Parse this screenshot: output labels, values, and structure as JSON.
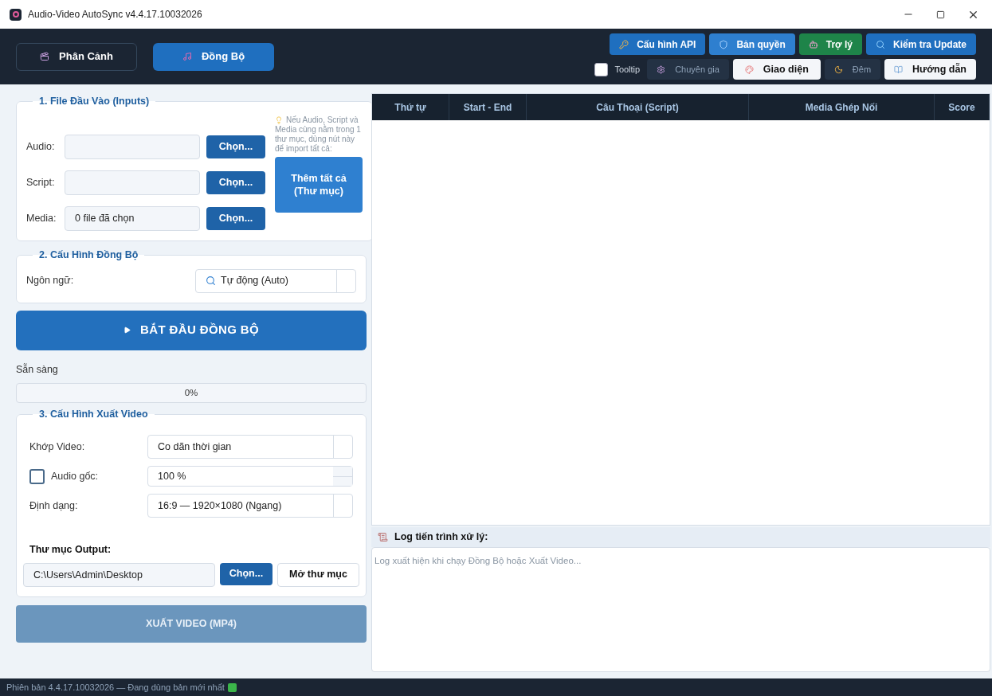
{
  "window": {
    "title": "Audio-Video AutoSync  v4.4.17.10032026"
  },
  "mode_tabs": [
    {
      "label": "Phân Cảnh",
      "selected": false
    },
    {
      "label": "Đồng Bộ",
      "selected": true
    }
  ],
  "top_buttons": [
    {
      "label": "Cấu hình API",
      "color": "#1f6fbf"
    },
    {
      "label": "Bản quyền",
      "color": "#2e7fcf"
    },
    {
      "label": "Trợ lý",
      "color": "#1e8449"
    },
    {
      "label": "Kiểm tra Update",
      "color": "#1f6fbf"
    }
  ],
  "tooltip_toggle": {
    "label": "Tooltip",
    "checked": false
  },
  "view_buttons": [
    {
      "label": "Chuyên gia",
      "selected": false
    },
    {
      "label": "Giao diện",
      "selected": true
    },
    {
      "label": "Đêm",
      "selected": false
    },
    {
      "label": "Hướng dẫn",
      "selected": true
    }
  ],
  "inputs": {
    "title": "1. File Đầu Vào (Inputs)",
    "rows": [
      {
        "label": "Audio:",
        "value": "",
        "button": "Chọn..."
      },
      {
        "label": "Script:",
        "value": "",
        "button": "Chọn..."
      },
      {
        "label": "Media:",
        "value": "0 file đã chọn",
        "button": "Chọn..."
      }
    ],
    "hint": "Nếu Audio, Script và Media cùng nằm trong 1 thư mục, dùng nút này để import tất cả:",
    "add_all_button": "Thêm tất cả (Thư mục)"
  },
  "sync_config": {
    "title": "2. Cấu Hình Đồng Bộ",
    "label": "Ngôn ngữ:",
    "value": "Tự động (Auto)"
  },
  "start_button": {
    "label": "BẮT ĐẦU ĐỒNG BỘ"
  },
  "status": "Sẵn sàng",
  "progress": {
    "level": 0,
    "reading": "0%"
  },
  "export": {
    "title": "3. Cấu Hình Xuất Video",
    "rows": [
      {
        "kind": "select",
        "label": "Khớp Video:",
        "value": "Co dãn thời gian"
      },
      {
        "kind": "spin",
        "label": "Audio gốc:",
        "checked": false,
        "value": "100 %"
      },
      {
        "kind": "select",
        "label": "Định dạng:",
        "value": "16:9 — 1920×1080 (Ngang)"
      }
    ],
    "output_label": "Thư mục Output:",
    "output_path": "C:\\Users\\Admin\\Desktop",
    "choose_button": "Chọn...",
    "open_button": "Mở thư mục"
  },
  "export_button": {
    "label": "XUẤT VIDEO (MP4)",
    "disabled": true
  },
  "table": {
    "columns": [
      "Thứ tự",
      "Start - End",
      "Câu Thoại (Script)",
      "Media Ghép Nối",
      "Score"
    ]
  },
  "log": {
    "title": "Log tiến trình xử lý:",
    "placeholder": "Log xuất hiện khi chạy Đồng Bộ hoặc Xuất Video..."
  },
  "status_bar": "Phiên bản 4.4.17.10032026 — Đang dùng bản mới nhất"
}
